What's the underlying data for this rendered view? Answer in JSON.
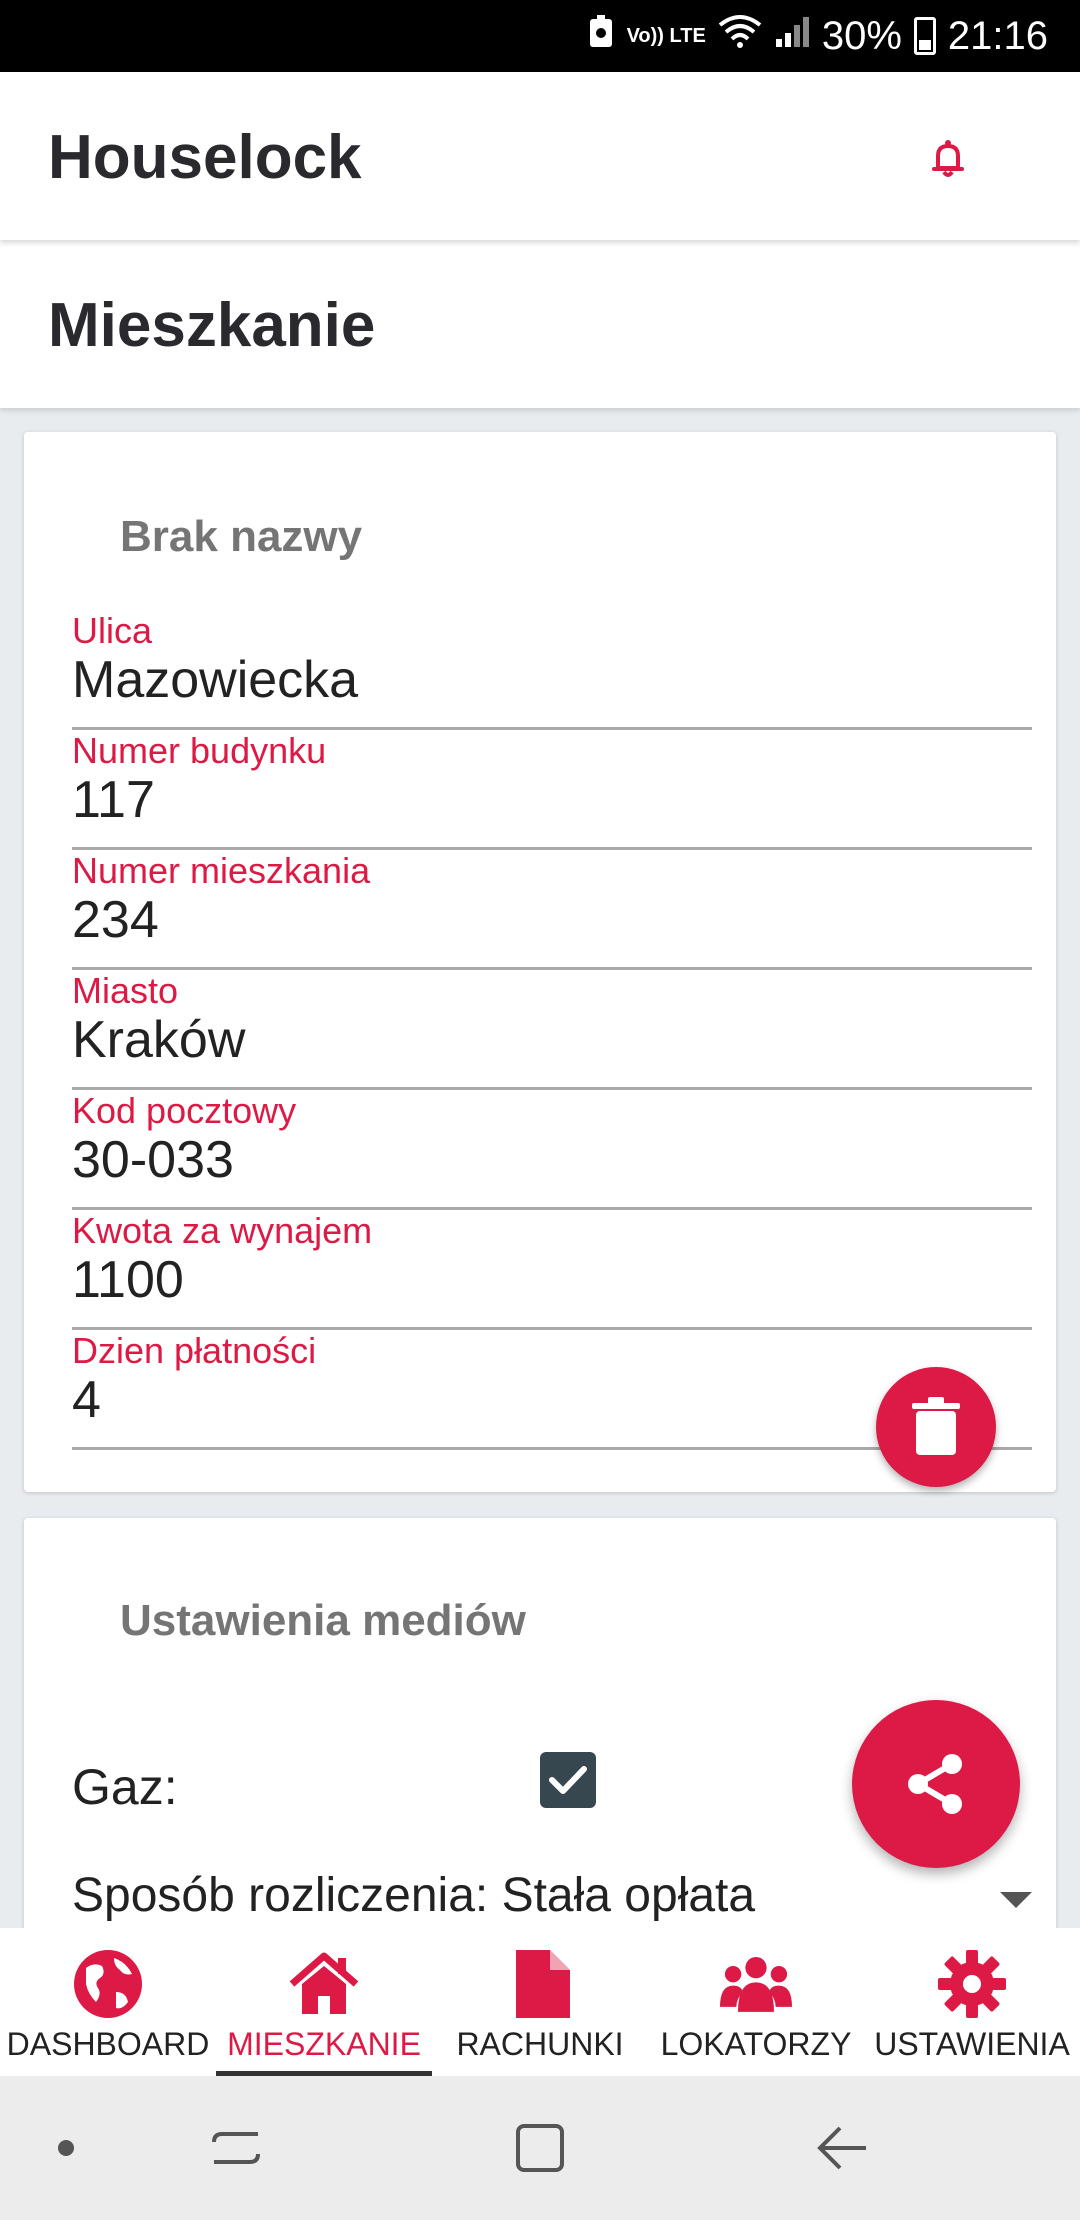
{
  "status_bar": {
    "battery": "30%",
    "time": "21:16",
    "network": "Vo)) LTE"
  },
  "app": {
    "title": "Houselock",
    "page_title": "Mieszkanie"
  },
  "apartment_card": {
    "title": "Brak nazwy",
    "fields": [
      {
        "label": "Ulica",
        "value": "Mazowiecka"
      },
      {
        "label": "Numer budynku",
        "value": "117"
      },
      {
        "label": "Numer mieszkania",
        "value": "234"
      },
      {
        "label": "Miasto",
        "value": "Kraków"
      },
      {
        "label": "Kod pocztowy",
        "value": "30-033"
      },
      {
        "label": "Kwota za wynajem",
        "value": "1100"
      },
      {
        "label": "Dzien płatności",
        "value": "4"
      }
    ]
  },
  "media_card": {
    "title": "Ustawienia mediów",
    "gas_label": "Gaz:",
    "gas_checked": true,
    "billing_text": "Sposób rozliczenia: Stała opłata"
  },
  "bottom_nav": {
    "items": [
      {
        "label": "DASHBOARD",
        "icon": "globe-icon"
      },
      {
        "label": "MIESZKANIE",
        "icon": "home-icon",
        "active": true
      },
      {
        "label": "RACHUNKI",
        "icon": "document-icon"
      },
      {
        "label": "LOKATORZY",
        "icon": "users-icon"
      },
      {
        "label": "USTAWIENIA",
        "icon": "gear-icon"
      }
    ]
  },
  "colors": {
    "accent": "#dc1a45",
    "text": "#222222",
    "muted": "#757575"
  }
}
